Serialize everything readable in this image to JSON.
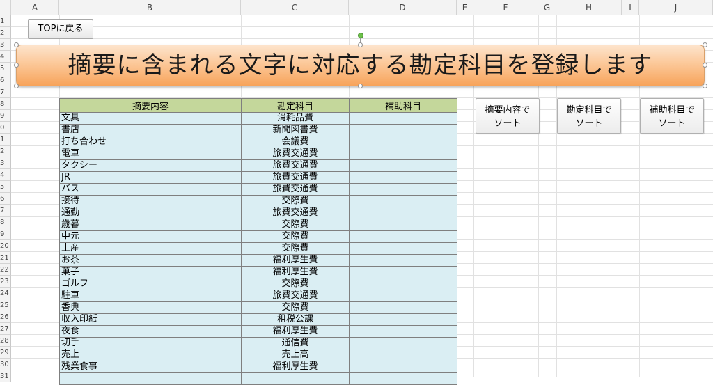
{
  "columns": [
    "A",
    "B",
    "C",
    "D",
    "E",
    "F",
    "G",
    "H",
    "I",
    "J"
  ],
  "rows": [
    "1",
    "2",
    "3",
    "4",
    "5",
    "6",
    "7",
    "8",
    "9",
    "0",
    "1",
    "2",
    "3",
    "4",
    "5",
    "6",
    "7",
    "8",
    "9",
    "20",
    "21",
    "22",
    "23",
    "24",
    "25",
    "26",
    "27",
    "28",
    "29",
    "30",
    "31"
  ],
  "top_button": "TOPに戻る",
  "banner_title": "摘要に含まれる文字に対応する勘定科目を登録します",
  "table": {
    "headers": [
      "摘要内容",
      "勘定科目",
      "補助科目"
    ],
    "rows": [
      [
        "文具",
        "消耗品費",
        ""
      ],
      [
        "書店",
        "新聞図書費",
        ""
      ],
      [
        "打ち合わせ",
        "会議費",
        ""
      ],
      [
        "電車",
        "旅費交通費",
        ""
      ],
      [
        "タクシー",
        "旅費交通費",
        ""
      ],
      [
        "JR",
        "旅費交通費",
        ""
      ],
      [
        "バス",
        "旅費交通費",
        ""
      ],
      [
        "接待",
        "交際費",
        ""
      ],
      [
        "通勤",
        "旅費交通費",
        ""
      ],
      [
        "歳暮",
        "交際費",
        ""
      ],
      [
        "中元",
        "交際費",
        ""
      ],
      [
        "土産",
        "交際費",
        ""
      ],
      [
        "お茶",
        "福利厚生費",
        ""
      ],
      [
        "菓子",
        "福利厚生費",
        ""
      ],
      [
        "ゴルフ",
        "交際費",
        ""
      ],
      [
        "駐車",
        "旅費交通費",
        ""
      ],
      [
        "香典",
        "交際費",
        ""
      ],
      [
        "収入印紙",
        "租税公課",
        ""
      ],
      [
        "夜食",
        "福利厚生費",
        ""
      ],
      [
        "切手",
        "通信費",
        ""
      ],
      [
        "売上",
        "売上高",
        ""
      ],
      [
        "残業食事",
        "福利厚生費",
        ""
      ],
      [
        "",
        "",
        ""
      ]
    ]
  },
  "sort_buttons": [
    {
      "line1": "摘要内容で",
      "line2": "ソート"
    },
    {
      "line1": "勘定科目で",
      "line2": "ソート"
    },
    {
      "line1": "補助科目で",
      "line2": "ソート"
    }
  ]
}
